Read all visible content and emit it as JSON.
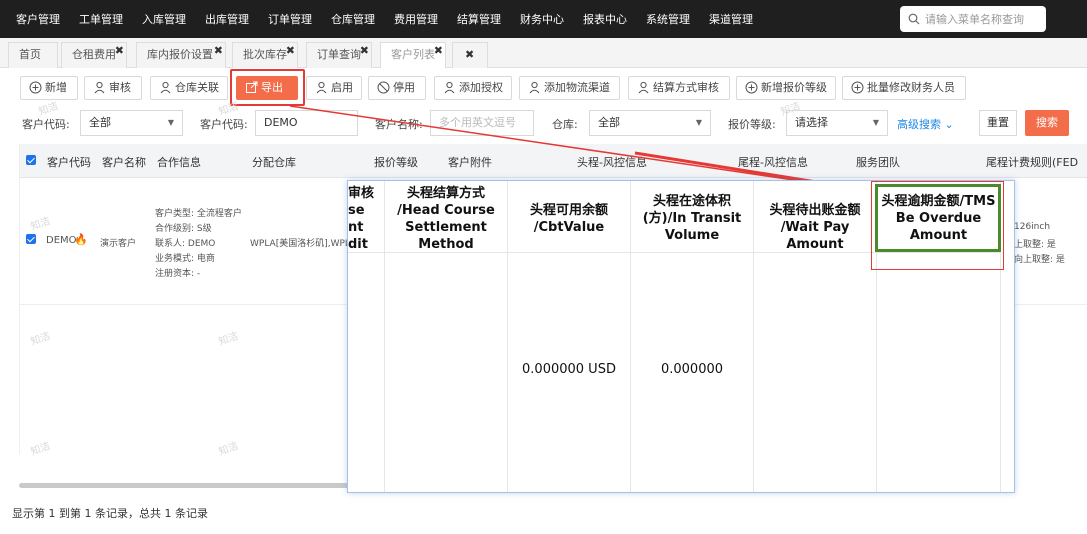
{
  "topnav": {
    "items": [
      "客户管理",
      "工单管理",
      "入库管理",
      "出库管理",
      "订单管理",
      "仓库管理",
      "费用管理",
      "结算管理",
      "财务中心",
      "报表中心",
      "系统管理",
      "渠道管理"
    ],
    "search_placeholder": "请输入菜单名称查询"
  },
  "tabs": [
    {
      "label": "首页"
    },
    {
      "label": "仓租费用"
    },
    {
      "label": "库内报价设置"
    },
    {
      "label": "批次库存"
    },
    {
      "label": "订单查询"
    },
    {
      "label": "客户列表"
    }
  ],
  "tab_close": "✖",
  "toolbar": {
    "add": "新增",
    "audit": "审核",
    "wh_link": "仓库关联",
    "export": "导出",
    "enable": "启用",
    "disable": "停用",
    "add_auth": "添加授权",
    "add_channel": "添加物流渠道",
    "settle_audit": "结算方式审核",
    "add_quote_level": "新增报价等级",
    "batch_finance": "批量修改财务人员"
  },
  "filters": {
    "cust_code_label": "客户代码:",
    "cust_code_value": "全部",
    "cust_code2_label": "客户代码:",
    "cust_code2_value": "DEMO",
    "cust_name_label": "客户名称:",
    "cust_name_placeholder": "多个用英文逗号",
    "warehouse_label": "仓库:",
    "warehouse_value": "全部",
    "quote_level_label": "报价等级:",
    "quote_level_value": "请选择",
    "advanced": "高级搜索",
    "reset": "重置",
    "search": "搜索"
  },
  "grid": {
    "headers": [
      "客户代码",
      "客户名称",
      "合作信息",
      "分配仓库",
      "报价等级",
      "客户附件",
      "头程-风控信息",
      "尾程-风控信息",
      "服务团队",
      "尾程计费规则(FED"
    ],
    "row": {
      "code": "DEMO",
      "name": "演示客户",
      "coop_type": "客户类型: 全流程客户",
      "coop_level": "合作级别: S级",
      "contact": "联系人: DEMO",
      "business": "业务模式: 电商",
      "capital": "注册资本: -",
      "warehouse": "WPLA[美国洛杉矶],WPL",
      "fed_1": "126inch",
      "fed_2": "上取整: 是",
      "fed_3": "向上取整: 是"
    }
  },
  "watermark": "知洁",
  "footer": "显示第 1 到第 1 条记录，总共 1 条记录",
  "zoom": {
    "c0": [
      "审核",
      "se",
      "nt",
      "dit"
    ],
    "c1": [
      "头程结算方式",
      "/Head Course",
      "Settlement",
      "Method"
    ],
    "c2": [
      "头程可用余额",
      "/CbtValue"
    ],
    "c3": [
      "头程在途体积",
      "(方)/In Transit",
      "Volume"
    ],
    "c4": [
      "头程待出账金额",
      "/Wait Pay Amount"
    ],
    "c5": [
      "头程逾期金额/TMS",
      "Be Overdue",
      "Amount"
    ],
    "v2": "0.000000 USD",
    "v3": "0.000000"
  },
  "colors": {
    "accent": "#f36d4b",
    "link": "#1e88e5",
    "nav_bg": "#1f1f1f",
    "highlight_red": "#e53935",
    "highlight_green": "#4a8a2a"
  }
}
